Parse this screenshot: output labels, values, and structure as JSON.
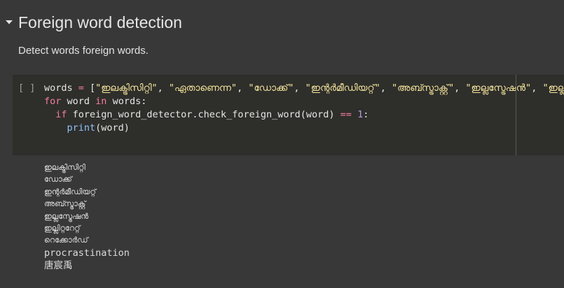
{
  "section": {
    "title": "Foreign word detection",
    "collapse_icon": "caret-down-icon"
  },
  "description": "Detect words foreign words.",
  "code_cell": {
    "run_indicator": "[ ]",
    "line1": {
      "var": "words",
      "eq": " = ",
      "open": "[",
      "strings": [
        "\"ഇലക്ട്രിസിറ്റി\"",
        "\"ഏതാണെന്ന\"",
        "\"ഡോക്ക്\"",
        "\"ഇന്റർമീഡിയറ്റ്\"",
        "\"അബ്സ്ട്രാക്റ്റ്\"",
        "\"ഇല്ലസ്ട്രേഷൻ\"",
        "\"ഇല്ലിറ്ററേറ്റ്\""
      ],
      "sep": ", "
    },
    "line2": {
      "kw_for": "for",
      "var": " word ",
      "kw_in": "in",
      "rest": " words:"
    },
    "line3": {
      "indent": "  ",
      "kw_if": "if",
      "call": " foreign_word_detector.check_foreign_word(word) ",
      "op": "==",
      "space": " ",
      "num": "1",
      "colon": ":"
    },
    "line4": {
      "indent": "    ",
      "fn": "print",
      "args": "(word)"
    }
  },
  "output": {
    "lines": [
      "ഇലക്ട്രിസിറ്റി",
      "ഡോക്ക്",
      "ഇന്റർമീഡിയറ്റ്",
      "അബ്സ്ട്രാക്റ്റ്",
      "ഇല്ലസ്ട്രേഷൻ",
      "ഇല്ലിറ്ററേറ്റ്",
      "റെക്കോർഡ്"
    ],
    "latin_line": "procrastination",
    "cjk_line": "唐宸禹"
  },
  "colors": {
    "background": "#383838",
    "code_background": "#2e2e2b",
    "keyword": "#f37f9a",
    "string": "#f7e79c",
    "number": "#b39ddb",
    "function": "#8fc3f5"
  }
}
